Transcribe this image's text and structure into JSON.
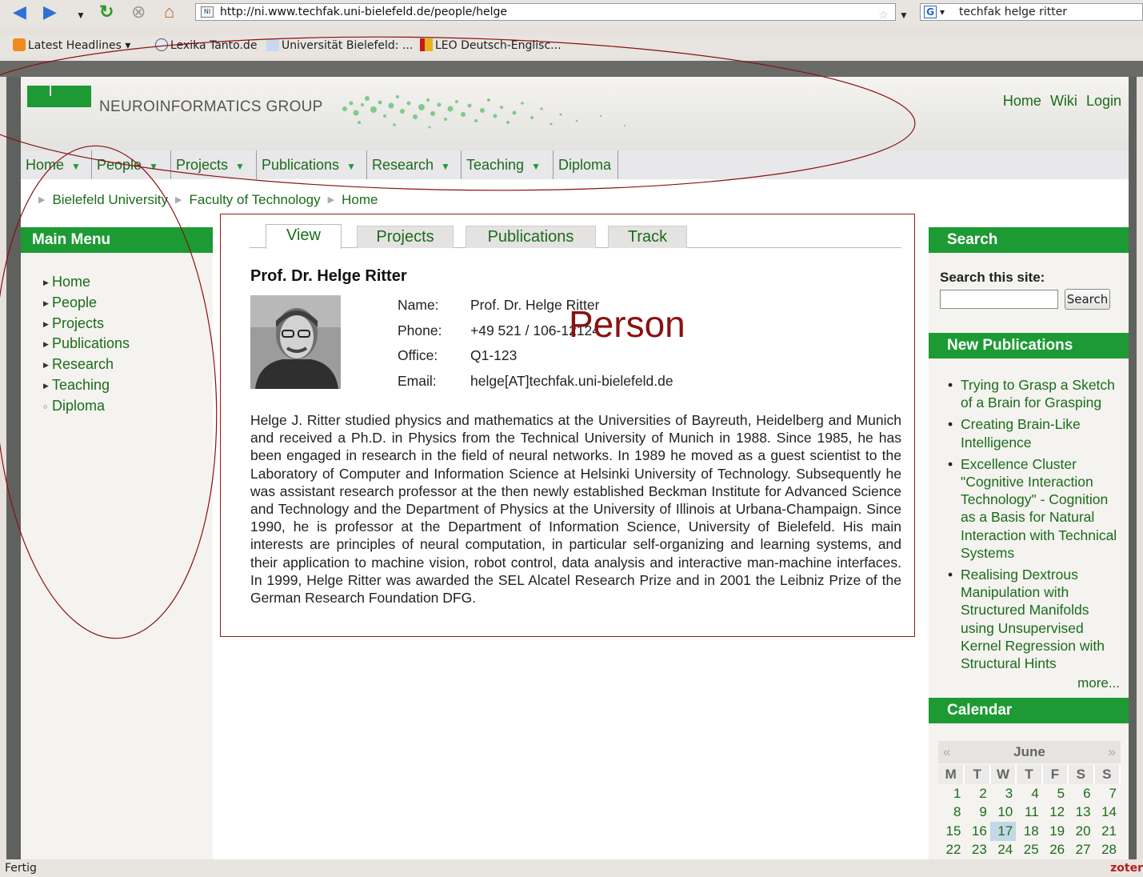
{
  "browser": {
    "url": "http://ni.www.techfak.uni-bielefeld.de/people/helge",
    "search_query": "techfak helge ritter",
    "favicon_text": "NI",
    "status_text": "Fertig",
    "zotero_label": "zoter",
    "bookmarks": [
      {
        "label": "Latest Headlines ▾",
        "icon": "rss-icon"
      },
      {
        "label": "Lexika Tanto.de",
        "icon": "globe-icon"
      },
      {
        "label": "Universität Bielefeld: ...",
        "icon": "university-icon"
      },
      {
        "label": "LEO Deutsch-Englisc...",
        "icon": "leo-icon"
      }
    ]
  },
  "site": {
    "name": "NEUROINFORMATICS GROUP",
    "util_links": [
      "Home",
      "Wiki",
      "Login"
    ],
    "nav": [
      {
        "label": "Home",
        "has_arrow": true
      },
      {
        "label": "People",
        "has_arrow": true
      },
      {
        "label": "Projects",
        "has_arrow": true
      },
      {
        "label": "Publications",
        "has_arrow": true
      },
      {
        "label": "Research",
        "has_arrow": true
      },
      {
        "label": "Teaching",
        "has_arrow": true
      },
      {
        "label": "Diploma",
        "has_arrow": false
      }
    ],
    "breadcrumb": [
      "Bielefeld University",
      "Faculty of Technology",
      "Home"
    ]
  },
  "left": {
    "title": "Main Menu",
    "items": [
      "Home",
      "People",
      "Projects",
      "Publications",
      "Research",
      "Teaching",
      "Diploma"
    ]
  },
  "content": {
    "tabs": [
      "View",
      "Projects",
      "Publications",
      "Track"
    ],
    "active_tab": "View",
    "name": "Prof. Dr. Helge Ritter",
    "fields": [
      {
        "key": "Name:",
        "value": "Prof. Dr. Helge Ritter"
      },
      {
        "key": "Phone:",
        "value": "+49 521 / 106-12124"
      },
      {
        "key": "Office:",
        "value": "Q1-123"
      },
      {
        "key": "Email:",
        "value": "helge[AT]techfak.uni-bielefeld.de"
      }
    ],
    "annotation": "Person",
    "bio": "Helge J. Ritter studied physics and mathematics at the Universities of Bayreuth, Heidelberg and Munich and received a Ph.D. in Physics from the Technical University of Munich in 1988. Since 1985, he has been engaged in research in the field of neural networks. In 1989 he moved as a guest scientist to the Laboratory of Computer and Information Science at Helsinki University of Technology. Subsequently he was assistant research professor at the then newly established Beckman Institute for Advanced Science and Technology and the Department of Physics at the University of Illinois at Urbana-Champaign. Since 1990, he is professor at the Department of Information Science, University of Bielefeld. His main interests are principles of neural computation, in particular self-organizing and learning systems, and their application to machine vision, robot control, data analysis and interactive man-machine interfaces. In 1999, Helge Ritter was awarded the SEL Alcatel Research Prize and in 2001 the Leibniz Prize of the German Research Foundation DFG."
  },
  "right": {
    "search_title": "Search",
    "search_label": "Search this site:",
    "search_button": "Search",
    "search_value": "",
    "pubs_title": "New Publications",
    "pubs": [
      "Trying to Grasp a Sketch of a Brain for Grasping",
      "Creating Brain-Like Intelligence",
      "Excellence Cluster \"Cognitive Interaction Technology\" - Cognition as a Basis for Natural Interaction with Technical Systems",
      "Realising Dextrous Manipulation with Structured Manifolds using Unsupervised Kernel Regression with Structural Hints"
    ],
    "more": "more...",
    "calendar_title": "Calendar",
    "calendar": {
      "prev": "«",
      "next": "»",
      "month": "June",
      "weekdays": [
        "M",
        "T",
        "W",
        "T",
        "F",
        "S",
        "S"
      ],
      "weeks": [
        [
          "1",
          "2",
          "3",
          "4",
          "5",
          "6",
          "7"
        ],
        [
          "8",
          "9",
          "10",
          "11",
          "12",
          "13",
          "14"
        ],
        [
          "15",
          "16",
          "17",
          "18",
          "19",
          "20",
          "21"
        ],
        [
          "22",
          "23",
          "24",
          "25",
          "26",
          "27",
          "28"
        ]
      ],
      "today": "17"
    }
  },
  "colors": {
    "brand_green": "#1d9a34",
    "link_green": "#1b6b1b",
    "annotation_red": "#8a1111"
  }
}
